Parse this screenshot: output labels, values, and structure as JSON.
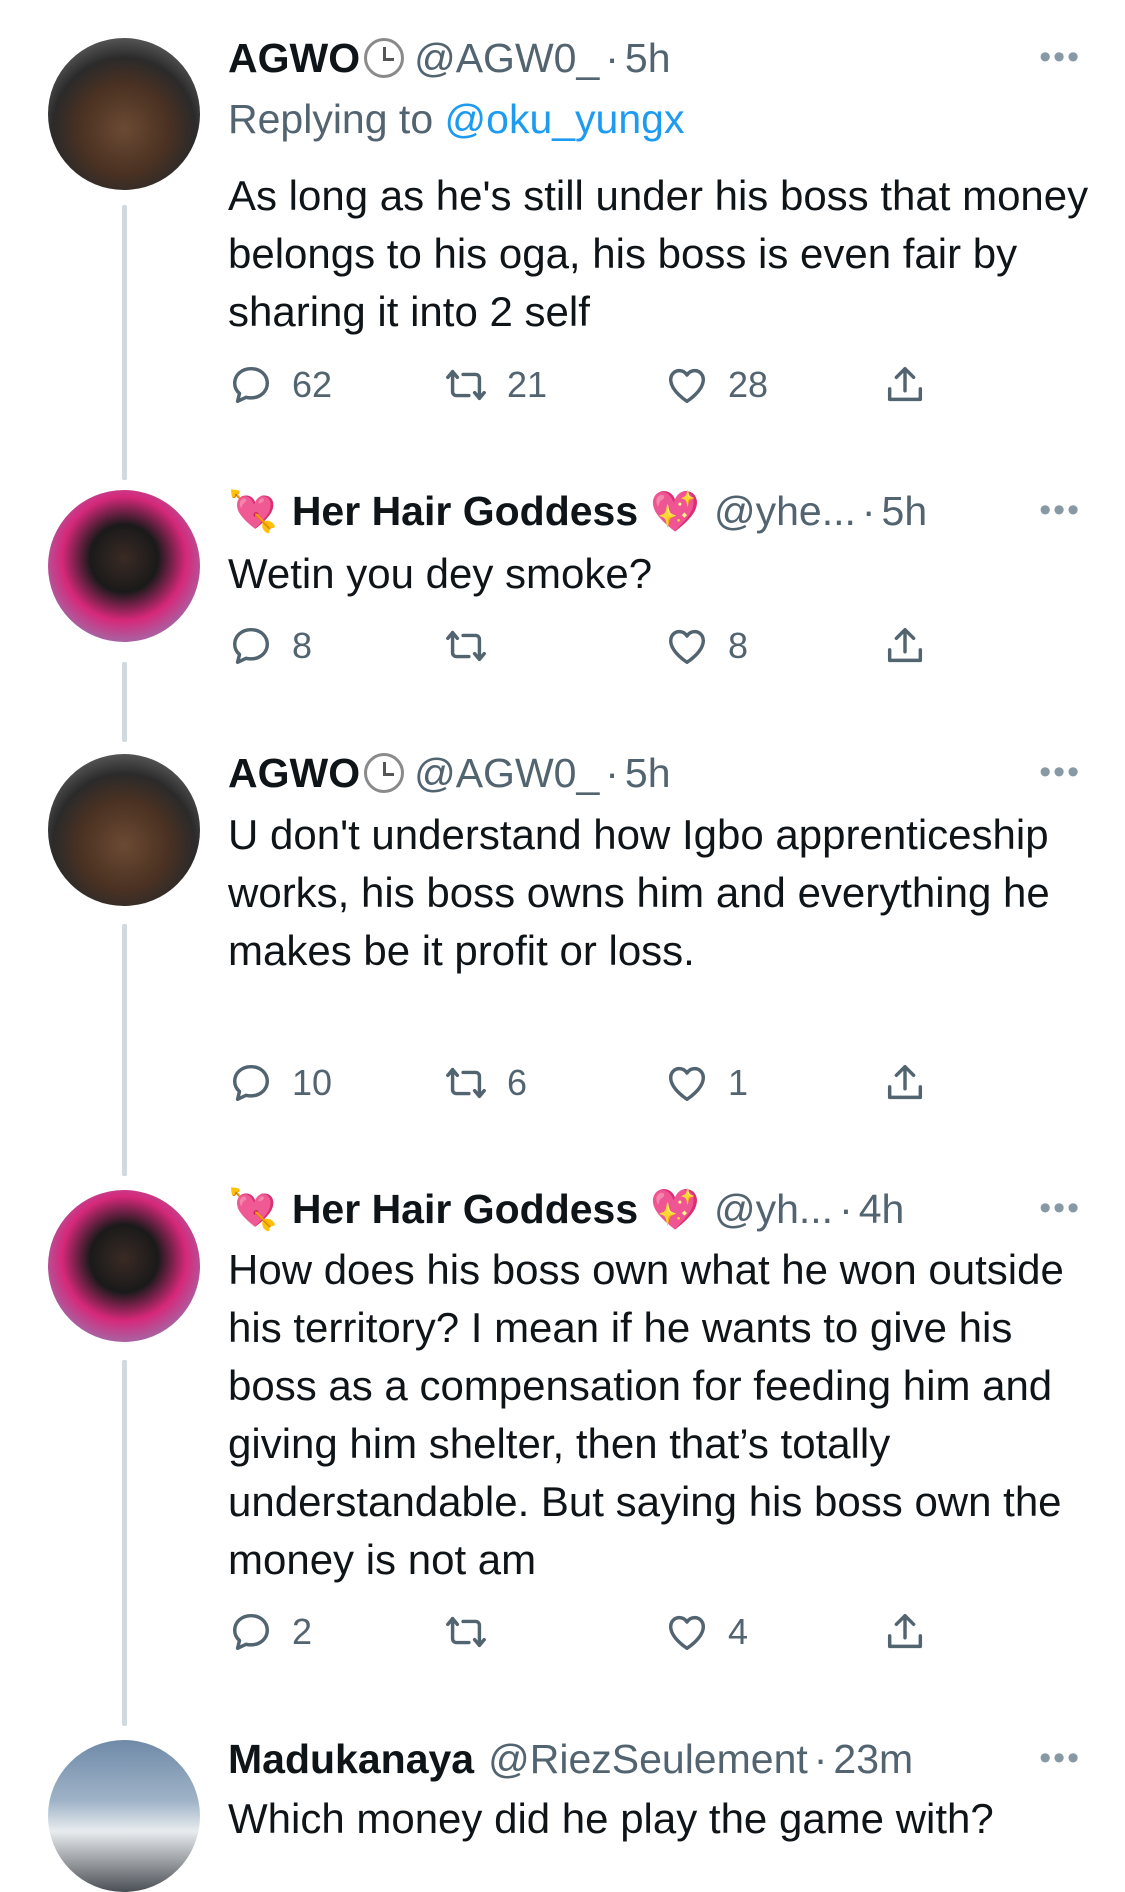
{
  "tweets": [
    {
      "name": "AGWO",
      "handle": "@AGW0_",
      "time": "5h",
      "more": "•••",
      "reply_prefix": "Replying to ",
      "reply_handle": "@oku_yungx",
      "text": "As long as he's still under his boss that money belongs to his oga, his boss is even fair by sharing it into 2 self",
      "replies": "62",
      "retweets": "21",
      "likes": "28"
    },
    {
      "name": "Her Hair Goddess",
      "left_emoji": "💘",
      "right_emoji": "💖",
      "handle": "@yhe...",
      "time": "5h",
      "more": "•••",
      "text": "Wetin you dey smoke?",
      "replies": "8",
      "retweets": "",
      "likes": "8"
    },
    {
      "name": "AGWO",
      "handle": "@AGW0_",
      "time": "5h",
      "more": "•••",
      "text": "U don't understand how Igbo apprenticeship works, his boss owns him and everything he makes be it profit or loss.",
      "replies": "10",
      "retweets": "6",
      "likes": "1"
    },
    {
      "name": "Her Hair Goddess",
      "left_emoji": "💘",
      "right_emoji": "💖",
      "handle": "@yh...",
      "time": "4h",
      "more": "•••",
      "text": "How does his boss own what he won outside his territory? I mean if he wants to give his boss as a compensation for feeding him and giving him shelter, then that’s totally understandable. But saying his boss own the money is not am",
      "replies": "2",
      "retweets": "",
      "likes": "4"
    },
    {
      "name": "Madukanaya",
      "handle": "@RiezSeulement",
      "time": "23m",
      "more": "•••",
      "text": "Which money did he play the game with?"
    }
  ],
  "colors": {
    "link": "#1d9bf0",
    "muted": "#536471",
    "thread_line": "#cfd9de"
  },
  "icons": [
    "reply-icon",
    "retweet-icon",
    "like-icon",
    "share-icon",
    "clock-icon",
    "more-icon"
  ]
}
